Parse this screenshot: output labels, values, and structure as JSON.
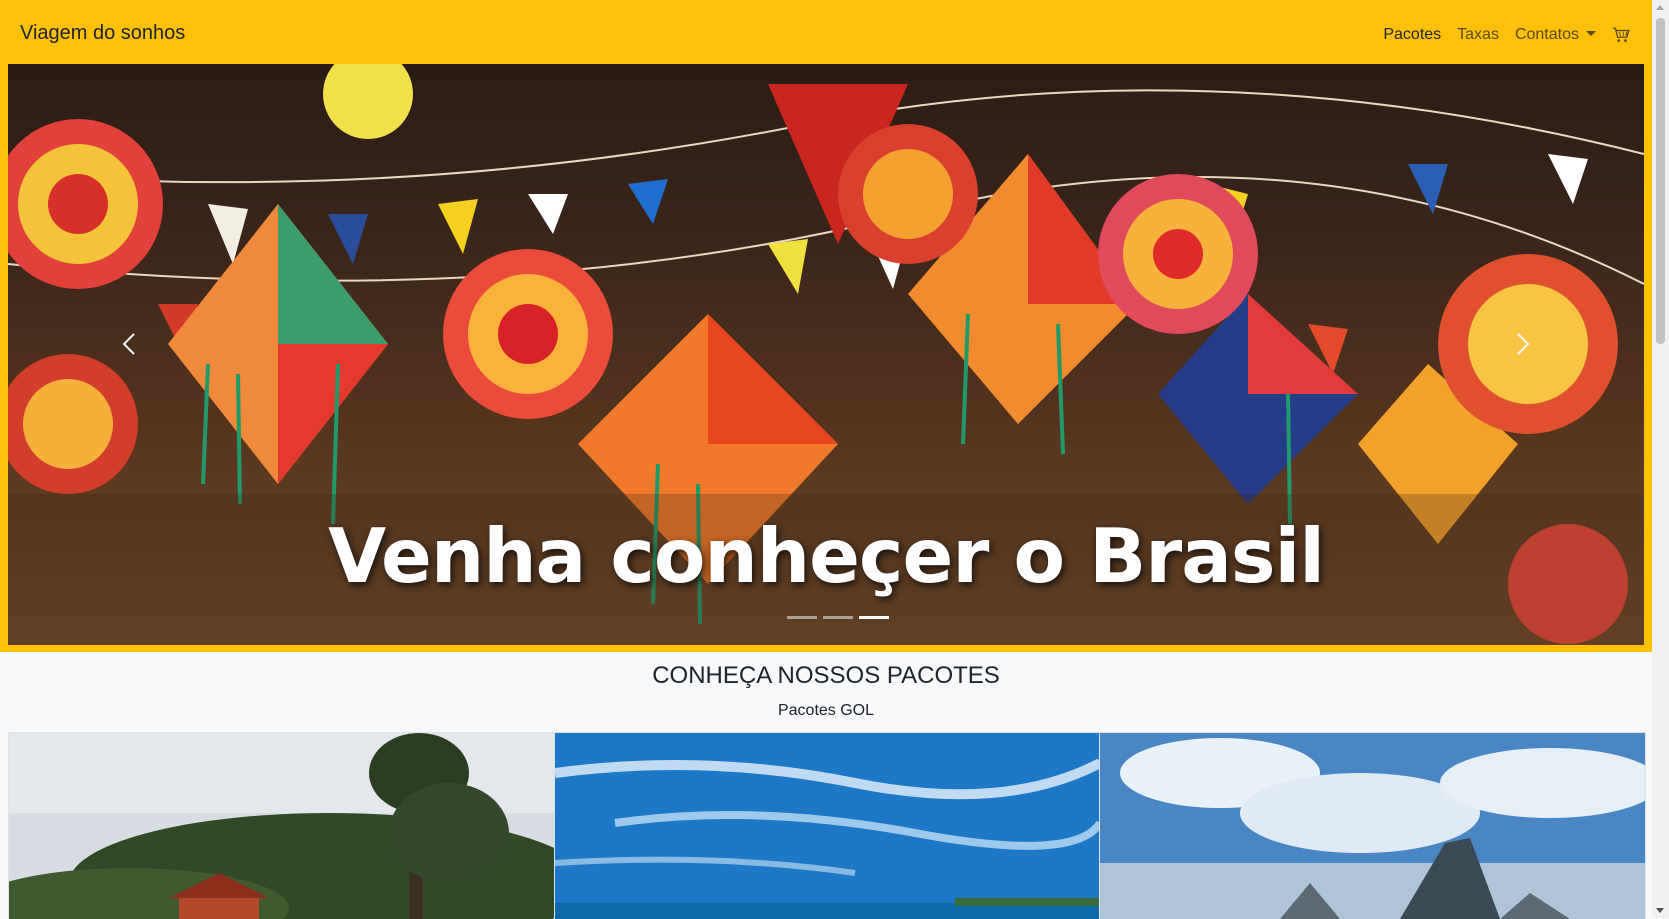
{
  "navbar": {
    "brand": "Viagem do sonhos",
    "items": [
      {
        "label": "Pacotes",
        "active": true
      },
      {
        "label": "Taxas",
        "active": false
      },
      {
        "label": "Contatos",
        "active": false
      }
    ],
    "cart_icon": "cart-icon",
    "background": "#ffc107"
  },
  "hero": {
    "caption": "Venha conheçer o Brasil",
    "slides_count": 3,
    "active_slide": 3,
    "prev_icon": "chevron-left-icon",
    "next_icon": "chevron-right-icon"
  },
  "packages": {
    "title": "CONHEÇA NOSSOS PACOTES",
    "subtitle": "Pacotes GOL"
  }
}
